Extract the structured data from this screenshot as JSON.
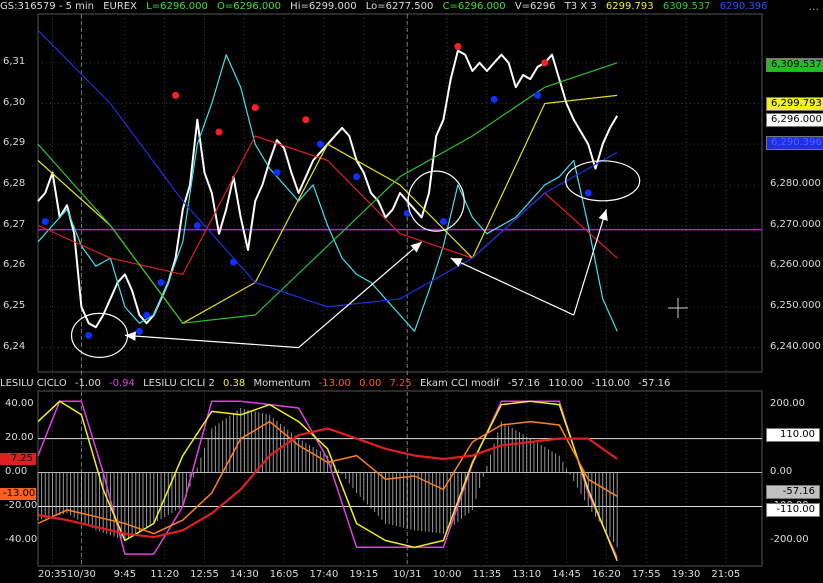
{
  "header": {
    "symbol": "GS:316579 - 5 min",
    "exchange": "EUREX",
    "last": "L=6296.000",
    "open": "O=6296.000",
    "high": "Hi=6299.000",
    "low": "Lo=6277.500",
    "close": "C=6296.000",
    "volume": "V=6296",
    "mult": "T3 X 3",
    "ma1": "6299.793",
    "ma2": "6309.537",
    "ma3": "6290.396",
    "menu": "..."
  },
  "colors": {
    "background": "#000000",
    "price": "#ffffff",
    "cyan_series": "#40e0f0",
    "red_ma": "#e02020",
    "yellow_ma": "#e0e020",
    "green_ma": "#30c030",
    "blue_ma": "#2030e0",
    "magenta_line": "#c020c0",
    "blue_dot": "#1030ff",
    "red_dot": "#ff2020"
  },
  "price_tags": [
    {
      "text": "6,309.537",
      "value": 6309.537,
      "bg": "#20c020",
      "fg": "#000000"
    },
    {
      "text": "6,299.793",
      "value": 6299.793,
      "bg": "#f0f020",
      "fg": "#000000"
    },
    {
      "text": "6,296.000",
      "value": 6296.0,
      "bg": "#ffffff",
      "fg": "#000000"
    },
    {
      "text": "6,290.396",
      "value": 6290.396,
      "bg": "#2030e0",
      "fg": "#5060ff"
    }
  ],
  "indicator_header": {
    "n1": "LESILU CICLO",
    "v1": "-1.00",
    "v1b": "-0.94",
    "n2": "LESILU CICLI 2",
    "v2": "0.38",
    "n3": "Momentum",
    "v3": "-13.00",
    "v3b": "0.00",
    "v3c": "7.25",
    "n4": "Ekam CCI modif",
    "v4": "-57.16",
    "v4b": "110.00",
    "v4c": "-110.00",
    "v4d": "-57.16"
  },
  "indicator_tags_left": [
    {
      "text": "7.25",
      "value": 7.25,
      "bg": "#e02020",
      "fg": "#000000"
    },
    {
      "text": "-13.00",
      "value": -13.0,
      "bg": "#ff6020",
      "fg": "#000000"
    }
  ],
  "indicator_tags_right": [
    {
      "text": "110.00",
      "value": 110,
      "bg": "#ffffff",
      "fg": "#000000"
    },
    {
      "text": "-57.16",
      "value": -57.16,
      "bg": "#c0c0c0",
      "fg": "#000000"
    },
    {
      "text": "-110.00",
      "value": -110,
      "bg": "#ffffff",
      "fg": "#000000"
    }
  ],
  "chart_data": [
    {
      "type": "line",
      "title": "GS:316579 - 5 min EUREX",
      "y_left_ticks": [
        "6,31",
        "6,30",
        "6,29",
        "6,28",
        "6,27",
        "6,26",
        "6,25",
        "6,24"
      ],
      "y_left_values": [
        6310,
        6300,
        6290,
        6280,
        6270,
        6260,
        6250,
        6240
      ],
      "y_right_ticks": [
        "6,280.000",
        "6,270.000",
        "6,260.000",
        "6,250.000",
        "6,240.000"
      ],
      "y_right_values": [
        6280,
        6270,
        6260,
        6250,
        6240
      ],
      "ylim": [
        6234,
        6322
      ],
      "x_ticks": [
        "20:35",
        "10/30",
        "9:45",
        "11:20",
        "12:55",
        "14:30",
        "16:05",
        "17:40",
        "19:15",
        "10/31",
        "10:00",
        "11:35",
        "13:10",
        "14:45",
        "16:20",
        "17:55",
        "19:30",
        "21:05"
      ],
      "xlim": [
        0,
        100
      ],
      "x_tick_pos": [
        2,
        6,
        12,
        17.5,
        23,
        28.5,
        34,
        39.5,
        45,
        51,
        56.5,
        62,
        67.5,
        73,
        78.5,
        84,
        89.5,
        95
      ],
      "horizontal_line": 6269,
      "series": [
        {
          "name": "price",
          "color": "#ffffff",
          "x": [
            0,
            1,
            2,
            3,
            4,
            5,
            6,
            7,
            8,
            9,
            10,
            11,
            12,
            13,
            14,
            15,
            16,
            17,
            18,
            19,
            20,
            21,
            22,
            23,
            24,
            25,
            26,
            27,
            28,
            29,
            30,
            31,
            32,
            33,
            34,
            35,
            36,
            37,
            38,
            39,
            40,
            41,
            42,
            43,
            44,
            45,
            46,
            47,
            48,
            49,
            50,
            51,
            52,
            53,
            54,
            55,
            56,
            57,
            58,
            59,
            60,
            61,
            62,
            63,
            64,
            65,
            66,
            67,
            68,
            69,
            70,
            71,
            72,
            73,
            74,
            75,
            76,
            77,
            78,
            79,
            80
          ],
          "values": [
            6276,
            6278,
            6283,
            6272,
            6275,
            6268,
            6250,
            6246,
            6245,
            6248,
            6252,
            6256,
            6258,
            6254,
            6248,
            6246,
            6248,
            6252,
            6256,
            6262,
            6274,
            6280,
            6296,
            6283,
            6278,
            6268,
            6274,
            6282,
            6272,
            6264,
            6276,
            6280,
            6286,
            6291,
            6289,
            6283,
            6278,
            6282,
            6286,
            6288,
            6290,
            6292,
            6294,
            6292,
            6286,
            6283,
            6278,
            6276,
            6272,
            6274,
            6278,
            6276,
            6274,
            6272,
            6278,
            6292,
            6296,
            6306,
            6313,
            6312,
            6308,
            6310,
            6308,
            6310,
            6312,
            6310,
            6304,
            6307,
            6306,
            6309,
            6310,
            6312,
            6306,
            6300,
            6296,
            6293,
            6290,
            6284,
            6290,
            6294,
            6297
          ]
        },
        {
          "name": "cyan",
          "color": "#40e0f0",
          "x": [
            0,
            2,
            4,
            6,
            8,
            10,
            12,
            14,
            16,
            18,
            20,
            22,
            24,
            26,
            28,
            30,
            32,
            34,
            36,
            38,
            40,
            42,
            44,
            46,
            48,
            50,
            52,
            54,
            56,
            58,
            60,
            62,
            64,
            66,
            68,
            70,
            72,
            74,
            76,
            78,
            80
          ],
          "values": [
            6266,
            6270,
            6274,
            6265,
            6260,
            6262,
            6250,
            6246,
            6248,
            6256,
            6266,
            6290,
            6300,
            6312,
            6304,
            6290,
            6284,
            6280,
            6276,
            6280,
            6270,
            6262,
            6258,
            6256,
            6252,
            6248,
            6244,
            6254,
            6265,
            6280,
            6272,
            6268,
            6270,
            6272,
            6276,
            6280,
            6282,
            6286,
            6270,
            6252,
            6244
          ]
        },
        {
          "name": "red_ma",
          "color": "#e02020",
          "x": [
            0,
            10,
            20,
            30,
            40,
            50,
            60,
            70,
            80
          ],
          "values": [
            6270,
            6262,
            6258,
            6292,
            6286,
            6268,
            6262,
            6278,
            6262
          ]
        },
        {
          "name": "yellow_ma",
          "color": "#e0e020",
          "x": [
            0,
            10,
            20,
            30,
            40,
            50,
            60,
            70,
            80
          ],
          "values": [
            6286,
            6270,
            6246,
            6256,
            6290,
            6280,
            6262,
            6300,
            6302
          ]
        },
        {
          "name": "green_ma",
          "color": "#30c030",
          "x": [
            0,
            10,
            20,
            30,
            40,
            50,
            60,
            70,
            80
          ],
          "values": [
            6290,
            6270,
            6246,
            6248,
            6265,
            6282,
            6292,
            6304,
            6310
          ]
        },
        {
          "name": "blue_ma",
          "color": "#2030e0",
          "x": [
            0,
            10,
            20,
            30,
            40,
            50,
            60,
            70,
            80
          ],
          "values": [
            6318,
            6300,
            6276,
            6256,
            6250,
            6252,
            6262,
            6278,
            6288
          ]
        }
      ],
      "blue_dots": [
        [
          1,
          6271
        ],
        [
          7,
          6243
        ],
        [
          14,
          6244
        ],
        [
          15,
          6248
        ],
        [
          17,
          6256
        ],
        [
          22,
          6270
        ],
        [
          27,
          6261
        ],
        [
          33,
          6283
        ],
        [
          39,
          6290
        ],
        [
          44,
          6282
        ],
        [
          51,
          6273
        ],
        [
          56,
          6271
        ],
        [
          63,
          6301
        ],
        [
          69,
          6302
        ],
        [
          76,
          6278
        ]
      ],
      "red_dots": [
        [
          19,
          6302
        ],
        [
          25,
          6293
        ],
        [
          30,
          6299
        ],
        [
          37,
          6296
        ],
        [
          58,
          6314
        ],
        [
          70,
          6310
        ]
      ]
    },
    {
      "type": "line",
      "title": "LESILU CICLO / LESILU CICLI 2 / Momentum / Ekam CCI modif",
      "y_left_ticks": [
        "40.00",
        "20.00",
        "0.00",
        "-20.00",
        "-40.00"
      ],
      "y_left_values": [
        40,
        20,
        0,
        -20,
        -40
      ],
      "y_right_ticks": [
        "200.00",
        "100.00",
        "0.00",
        "-100.00",
        "-200.00"
      ],
      "y_right_values": [
        200,
        100,
        0,
        -100,
        -200
      ],
      "ylim": [
        -55,
        48
      ],
      "h_lines": [
        20,
        0,
        -20
      ],
      "series": [
        {
          "name": "magenta",
          "color": "#e040e0",
          "x": [
            0,
            3,
            6,
            9,
            12,
            16,
            20,
            24,
            28,
            32,
            36,
            40,
            44,
            48,
            52,
            56,
            60,
            64,
            68,
            72,
            76,
            80
          ],
          "values": [
            10,
            42,
            42,
            0,
            -48,
            -48,
            -20,
            42,
            42,
            40,
            38,
            8,
            -44,
            -44,
            -44,
            -44,
            5,
            42,
            42,
            42,
            -12,
            -50
          ]
        },
        {
          "name": "yellow",
          "color": "#f0f020",
          "x": [
            0,
            3,
            6,
            9,
            12,
            16,
            20,
            24,
            28,
            32,
            36,
            40,
            44,
            48,
            52,
            56,
            60,
            64,
            68,
            72,
            76,
            80
          ],
          "values": [
            30,
            42,
            34,
            -10,
            -40,
            -30,
            10,
            36,
            34,
            40,
            30,
            14,
            -30,
            -40,
            -44,
            -40,
            6,
            40,
            42,
            40,
            -10,
            -52
          ]
        },
        {
          "name": "orange",
          "color": "#ff8020",
          "x": [
            0,
            4,
            8,
            12,
            16,
            20,
            24,
            28,
            32,
            36,
            40,
            44,
            48,
            52,
            56,
            60,
            64,
            68,
            72,
            76,
            80
          ],
          "values": [
            -30,
            -22,
            -26,
            -30,
            -36,
            -28,
            -12,
            20,
            30,
            16,
            6,
            10,
            -4,
            -2,
            -10,
            18,
            28,
            30,
            28,
            -4,
            -14
          ]
        },
        {
          "name": "red",
          "color": "#e02020",
          "x": [
            0,
            4,
            8,
            12,
            16,
            20,
            24,
            28,
            32,
            36,
            40,
            44,
            48,
            52,
            56,
            60,
            64,
            68,
            72,
            76,
            80
          ],
          "values": [
            -25,
            -28,
            -32,
            -36,
            -38,
            -34,
            -24,
            -10,
            10,
            22,
            26,
            20,
            14,
            10,
            8,
            10,
            16,
            18,
            20,
            20,
            8
          ]
        },
        {
          "name": "bars",
          "color": "#c0c0c0",
          "x": [
            0,
            4,
            8,
            12,
            16,
            20,
            24,
            28,
            32,
            36,
            40,
            44,
            48,
            52,
            56,
            60,
            64,
            68,
            72,
            76,
            80
          ],
          "values": [
            -28,
            -24,
            -34,
            -40,
            -30,
            -20,
            26,
            38,
            34,
            20,
            10,
            -12,
            -30,
            -34,
            -36,
            -22,
            30,
            20,
            10,
            -20,
            -44
          ]
        }
      ]
    }
  ]
}
